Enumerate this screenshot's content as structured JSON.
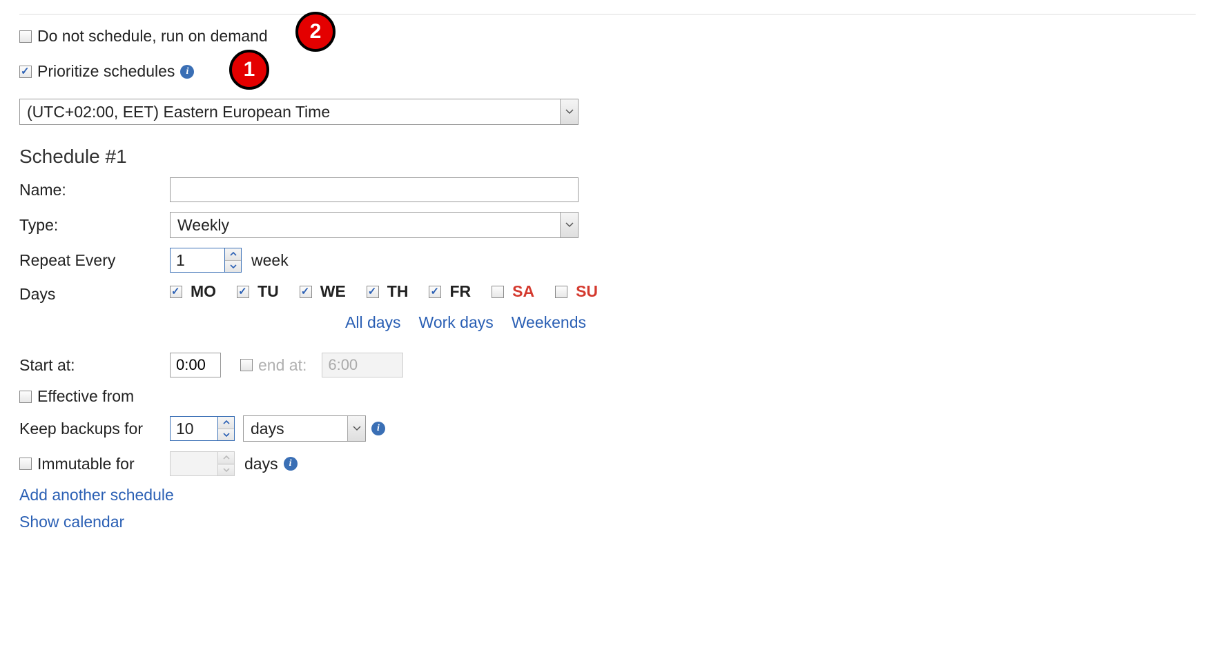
{
  "top": {
    "no_schedule_label": "Do not schedule, run on demand",
    "no_schedule_checked": false,
    "prioritize_label": "Prioritize schedules",
    "prioritize_checked": true,
    "timezone": "(UTC+02:00, EET) Eastern European Time"
  },
  "callouts": {
    "c1": "1",
    "c2": "2"
  },
  "schedule_heading": "Schedule #1",
  "labels": {
    "name": "Name:",
    "type": "Type:",
    "repeat": "Repeat Every",
    "week_unit": "week",
    "days": "Days",
    "all_days": "All days",
    "work_days": "Work days",
    "weekends": "Weekends",
    "start_at": "Start at:",
    "end_at": "end at:",
    "effective_from": "Effective from",
    "keep_backups": "Keep backups for",
    "immutable_for": "Immutable for",
    "days_unit": "days",
    "add_schedule": "Add another schedule",
    "show_calendar": "Show calendar"
  },
  "form": {
    "name_value": "",
    "type_value": "Weekly",
    "repeat_value": "1",
    "days": [
      {
        "code": "MO",
        "checked": true,
        "weekend": false
      },
      {
        "code": "TU",
        "checked": true,
        "weekend": false
      },
      {
        "code": "WE",
        "checked": true,
        "weekend": false
      },
      {
        "code": "TH",
        "checked": true,
        "weekend": false
      },
      {
        "code": "FR",
        "checked": true,
        "weekend": false
      },
      {
        "code": "SA",
        "checked": false,
        "weekend": true
      },
      {
        "code": "SU",
        "checked": false,
        "weekend": true
      }
    ],
    "start_at_value": "0:00",
    "end_at_enabled": false,
    "end_at_value": "6:00",
    "effective_from_checked": false,
    "keep_value": "10",
    "keep_unit_value": "days",
    "immutable_checked": false,
    "immutable_value": ""
  }
}
